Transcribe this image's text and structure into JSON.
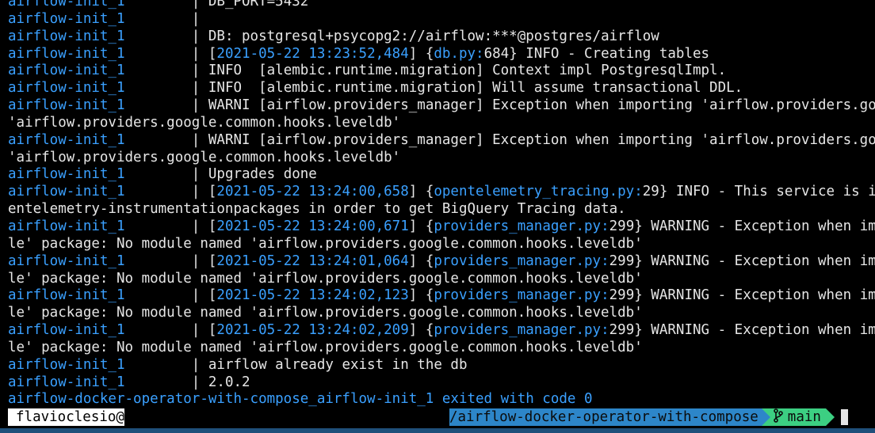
{
  "terminal": {
    "service": "airflow-init_1",
    "separator": "|",
    "lines": [
      {
        "svc": true,
        "text": " DB_PORT=5432"
      },
      {
        "svc": true,
        "text": ""
      },
      {
        "svc": true,
        "text": " DB: postgresql+psycopg2://airflow:***@postgres/airflow"
      },
      {
        "svc": true,
        "ts": "2021-05-22 13:23:52,484",
        "file": "db.py:",
        "line": "684",
        "rest": "} INFO - Creating tables"
      },
      {
        "svc": true,
        "text": " INFO  [alembic.runtime.migration] Context impl PostgresqlImpl."
      },
      {
        "svc": true,
        "text": " INFO  [alembic.runtime.migration] Will assume transactional DDL."
      },
      {
        "svc": true,
        "text": " WARNI [airflow.providers_manager] Exception when importing 'airflow.providers.google."
      },
      {
        "svc": false,
        "text": "'airflow.providers.google.common.hooks.leveldb'"
      },
      {
        "svc": true,
        "text": " WARNI [airflow.providers_manager] Exception when importing 'airflow.providers.google."
      },
      {
        "svc": false,
        "text": "'airflow.providers.google.common.hooks.leveldb'"
      },
      {
        "svc": true,
        "text": " Upgrades done"
      },
      {
        "svc": true,
        "ts": "2021-05-22 13:24:00,658",
        "file": "opentelemetry_tracing.py:",
        "line": "29",
        "rest": "} INFO - This service is instru"
      },
      {
        "svc": false,
        "text": "entelemetry-instrumentationpackages in order to get BigQuery Tracing data."
      },
      {
        "svc": true,
        "ts": "2021-05-22 13:24:00,671",
        "file": "providers_manager.py:",
        "line": "299",
        "rest": "} WARNING - Exception when importi"
      },
      {
        "svc": false,
        "text": "le' package: No module named 'airflow.providers.google.common.hooks.leveldb'"
      },
      {
        "svc": true,
        "ts": "2021-05-22 13:24:01,064",
        "file": "providers_manager.py:",
        "line": "299",
        "rest": "} WARNING - Exception when importi"
      },
      {
        "svc": false,
        "text": "le' package: No module named 'airflow.providers.google.common.hooks.leveldb'"
      },
      {
        "svc": true,
        "ts": "2021-05-22 13:24:02,123",
        "file": "providers_manager.py:",
        "line": "299",
        "rest": "} WARNING - Exception when importi"
      },
      {
        "svc": false,
        "text": "le' package: No module named 'airflow.providers.google.common.hooks.leveldb'"
      },
      {
        "svc": true,
        "ts": "2021-05-22 13:24:02,209",
        "file": "providers_manager.py:",
        "line": "299",
        "rest": "} WARNING - Exception when importi"
      },
      {
        "svc": false,
        "text": "le' package: No module named 'airflow.providers.google.common.hooks.leveldb'"
      },
      {
        "svc": true,
        "text": " airflow already exist in the db"
      },
      {
        "svc": true,
        "text": " 2.0.2"
      }
    ],
    "exit_line": "airflow-docker-operator-with-compose_airflow-init_1 exited with code 0"
  },
  "prompt": {
    "user": "flavioclesio@",
    "path": "/airflow-docker-operator-with-compose",
    "branch_icon": "git-branch-icon",
    "branch": "main"
  },
  "colors": {
    "background": "#000000",
    "service": "#3aa0ff",
    "text": "#e6e6e6",
    "path_segment": "#2d86c9",
    "git_segment": "#3ccf82"
  }
}
